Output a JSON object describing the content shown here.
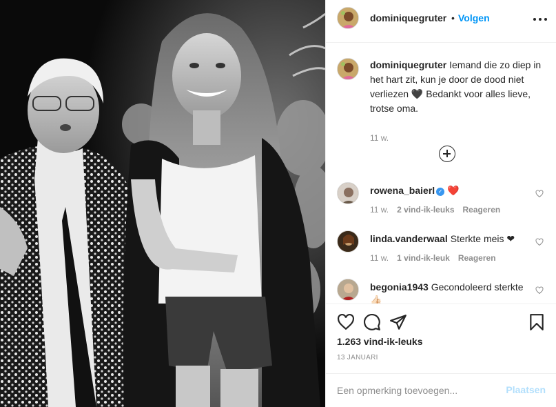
{
  "header": {
    "username": "dominiquegruter",
    "separator": "•",
    "follow_label": "Volgen",
    "more_icon": "more-horizontal-icon"
  },
  "caption": {
    "username": "dominiquegruter",
    "text": "Iemand die zo diep in het hart zit, kun je door de dood niet verliezen 🖤 Bedankt voor alles lieve, trotse oma.",
    "time": "11 w."
  },
  "load_more_icon": "plus-circle-icon",
  "comments": [
    {
      "username": "rowena_baierl",
      "text": "❤️",
      "verified": true,
      "time": "11 w.",
      "likes": "2 vind-ik-leuks",
      "reply": "Reageren"
    },
    {
      "username": "linda.vanderwaal",
      "text": "Sterkte meis ❤",
      "verified": false,
      "time": "11 w.",
      "likes": "1 vind-ik-leuk",
      "reply": "Reageren"
    },
    {
      "username": "begonia1943",
      "text": "Gecondoleerd sterkte 👍🏻",
      "verified": false,
      "time": "",
      "likes": "",
      "reply": ""
    }
  ],
  "actions": {
    "like_icon": "heart-icon",
    "comment_icon": "comment-icon",
    "share_icon": "send-icon",
    "save_icon": "bookmark-icon",
    "likes_count": "1.263 vind-ik-leuks",
    "date": "13 JANUARI"
  },
  "comment_box": {
    "placeholder": "Een opmerking toevoegen...",
    "post_label": "Plaatsen"
  },
  "colors": {
    "link_blue": "#0095f6",
    "post_disabled": "#b2dffc",
    "secondary_text": "#8e8e8e",
    "verified_blue": "#3897f0"
  }
}
